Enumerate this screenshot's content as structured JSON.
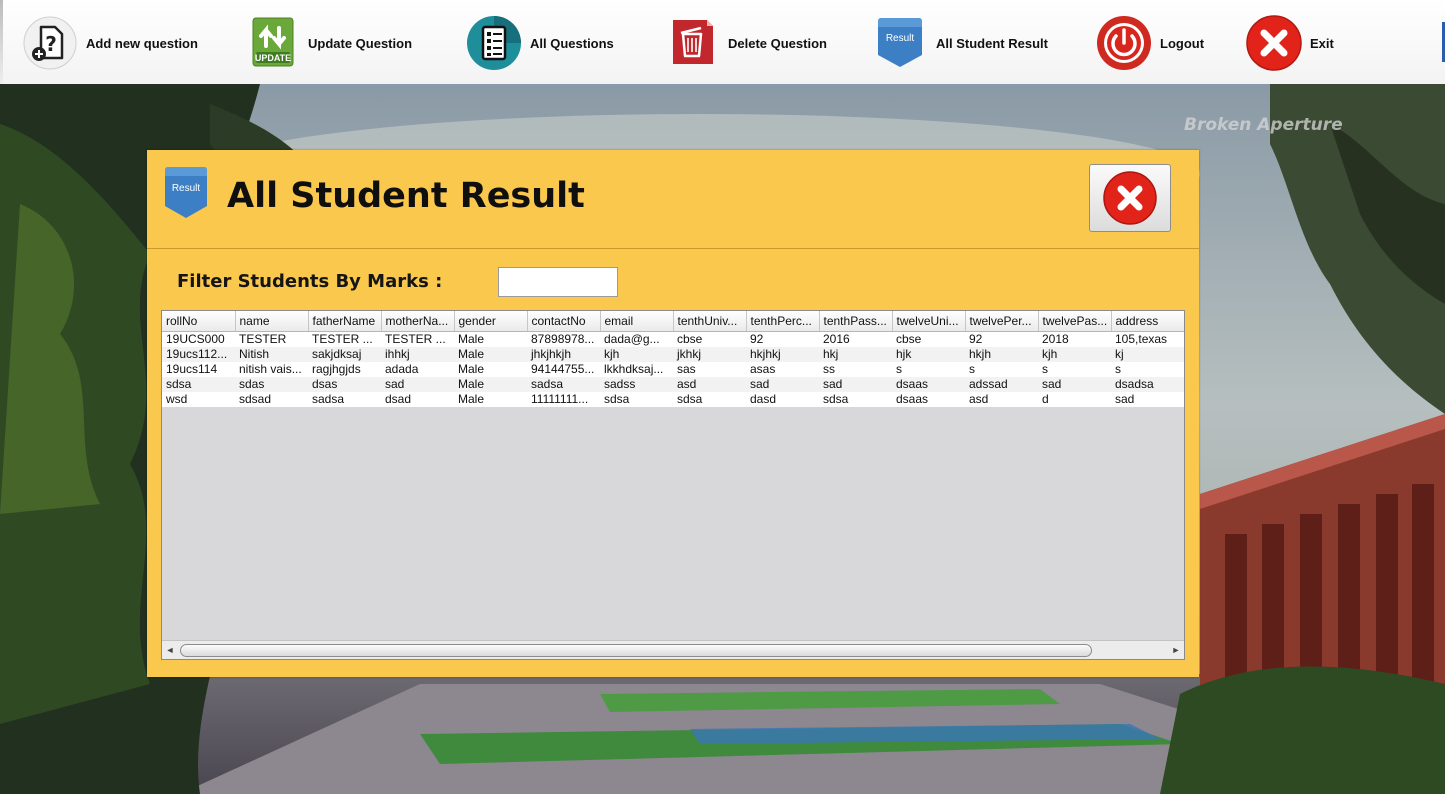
{
  "toolbar": {
    "items": [
      {
        "label": "Add new question",
        "icon": "add-question-icon"
      },
      {
        "label": "Update Question",
        "icon": "update-icon"
      },
      {
        "label": "All Questions",
        "icon": "list-icon"
      },
      {
        "label": "Delete Question",
        "icon": "trash-icon"
      },
      {
        "label": "All Student Result",
        "icon": "result-ribbon-icon"
      },
      {
        "label": "Logout",
        "icon": "power-icon"
      },
      {
        "label": "Exit",
        "icon": "close-circle-icon"
      }
    ]
  },
  "icon_text": {
    "update": "UPDATE",
    "result": "Result"
  },
  "background": {
    "watermark": "Broken Aperture"
  },
  "panel": {
    "title": "All Student Result",
    "badge": "Result",
    "filter_label": "Filter Students By Marks :",
    "filter_value": "",
    "background_color": "#f9c84c"
  },
  "table": {
    "columns": [
      "rollNo",
      "name",
      "fatherName",
      "motherNa...",
      "gender",
      "contactNo",
      "email",
      "tenthUniv...",
      "tenthPerc...",
      "tenthPass...",
      "twelveUni...",
      "twelvePer...",
      "twelvePas...",
      "address"
    ],
    "rows": [
      [
        "19UCS000",
        "TESTER",
        "TESTER ...",
        "TESTER ...",
        "Male",
        "87898978...",
        "dada@g...",
        "cbse",
        "92",
        "2016",
        "cbse",
        "92",
        "2018",
        "105,texas"
      ],
      [
        "19ucs112...",
        "Nitish",
        "sakjdksaj",
        "ihhkj",
        "Male",
        "jhkjhkjh",
        "kjh",
        "jkhkj",
        "hkjhkj",
        "hkj",
        "hjk",
        "hkjh",
        "kjh",
        "kj"
      ],
      [
        "19ucs114",
        "nitish vais...",
        "ragjhgjds",
        "adada",
        "Male",
        "94144755...",
        "lkkhdksaj...",
        "sas",
        "asas",
        "ss",
        "s",
        "s",
        "s",
        "s"
      ],
      [
        "sdsa",
        "sdas",
        "dsas",
        "sad",
        "Male",
        "sadsa",
        "sadss",
        "asd",
        "sad",
        "sad",
        "dsaas",
        "adssad",
        "sad",
        "dsadsa"
      ],
      [
        "wsd",
        "sdsad",
        "sadsa",
        "dsad",
        "Male",
        "11111111...",
        "sdsa",
        "sdsa",
        "dasd",
        "sdsa",
        "dsaas",
        "asd",
        "d",
        "sad"
      ]
    ]
  }
}
